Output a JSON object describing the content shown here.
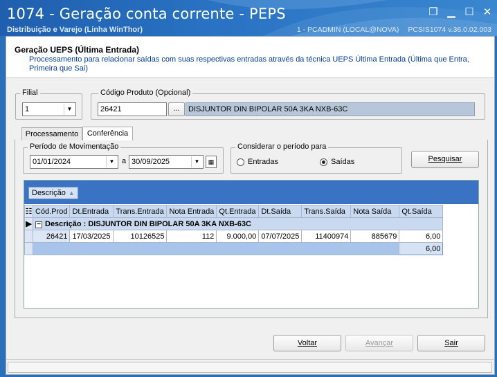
{
  "window": {
    "title": "1074 - Geração conta corrente - PEPS",
    "subtitle": "Distribuição e Varejo (Linha WinThor)",
    "user_info": "1 - PCADMIN (LOCAL@NOVA)",
    "version_info": "PCSIS1074  v.36.0.02.003"
  },
  "header": {
    "title": "Geração UEPS (Última Entrada)",
    "description": "Processamento para relacionar saídas com suas respectivas entradas através da técnica UEPS Última Entrada (Última que Entra, Primeira que Sai)"
  },
  "filial": {
    "label": "Filial",
    "value": "1"
  },
  "produto": {
    "label": "Código Produto (Opcional)",
    "code": "26421",
    "lookup_button": "...",
    "description": "DISJUNTOR DIN BIPOLAR  50A 3KA NXB-63C"
  },
  "tabs": [
    {
      "label": "Processamento",
      "active": false
    },
    {
      "label": "Conferência",
      "active": true
    }
  ],
  "periodo": {
    "label": "Período de Movimentação",
    "start": "01/01/2024",
    "separator": "a",
    "end": "30/09/2025"
  },
  "considerar": {
    "label": "Considerar o período para",
    "options": [
      {
        "label": "Entradas",
        "selected": false
      },
      {
        "label": "Saídas",
        "selected": true
      }
    ]
  },
  "search_button": "Pesquisar",
  "grid": {
    "group_by_chip": "Descrição",
    "columns": [
      "Cód.Prod",
      "Dt.Entrada",
      "Trans.Entrada",
      "Nota Entrada",
      "Qt.Entrada",
      "Dt.Saída",
      "Trans.Saída",
      "Nota Saída",
      "Qt.Saída"
    ],
    "group_row": "Descrição : DISJUNTOR DIN BIPOLAR  50A 3KA NXB-63C",
    "rows": [
      [
        "26421",
        "17/03/2025",
        "10126525",
        "112",
        "9.000,00",
        "07/07/2025",
        "11400974",
        "885679",
        "6,00"
      ]
    ],
    "summary": "6,00"
  },
  "footer": {
    "back": "Voltar",
    "next": "Avançar",
    "exit": "Sair"
  }
}
